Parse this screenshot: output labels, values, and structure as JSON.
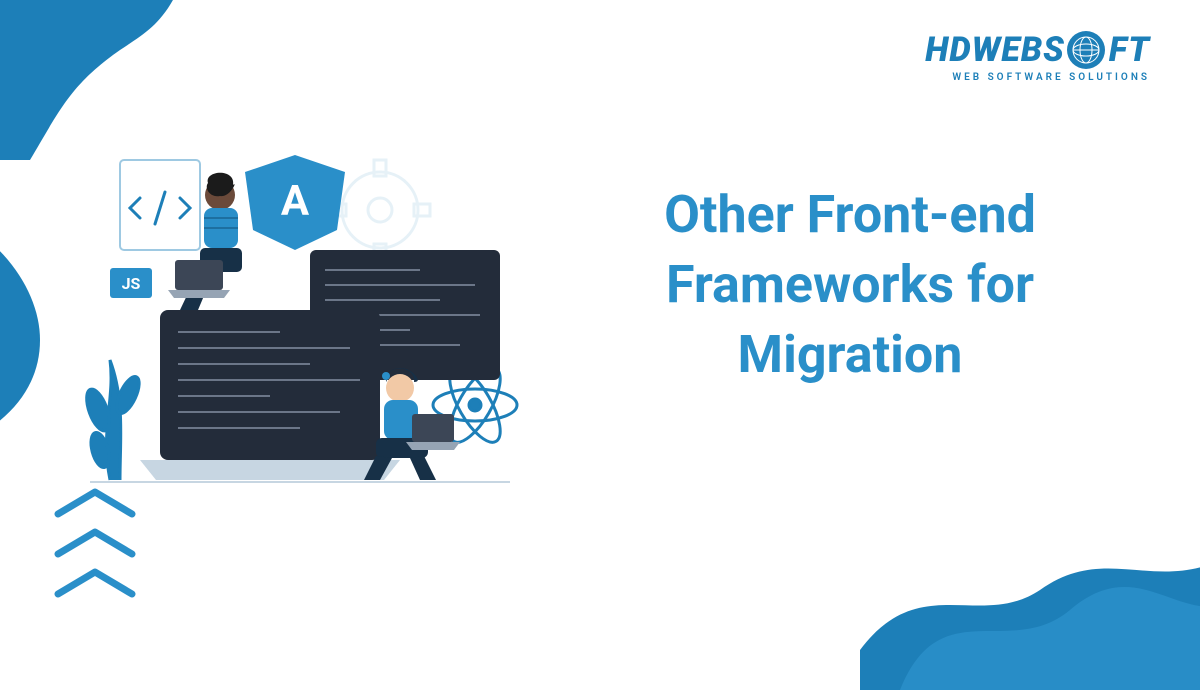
{
  "brand": {
    "name_part1": "HDWEBS",
    "name_part2": "FT",
    "tagline": "WEB SOFTWARE SOLUTIONS",
    "color": "#1d7fb8"
  },
  "headline": "Other Front-end Frameworks for Migration",
  "illustration": {
    "js_badge": "JS",
    "angular_letter": "A"
  },
  "colors": {
    "accent": "#2a8fc9",
    "dark": "#232c3a",
    "blob": "#1d7fb8"
  }
}
